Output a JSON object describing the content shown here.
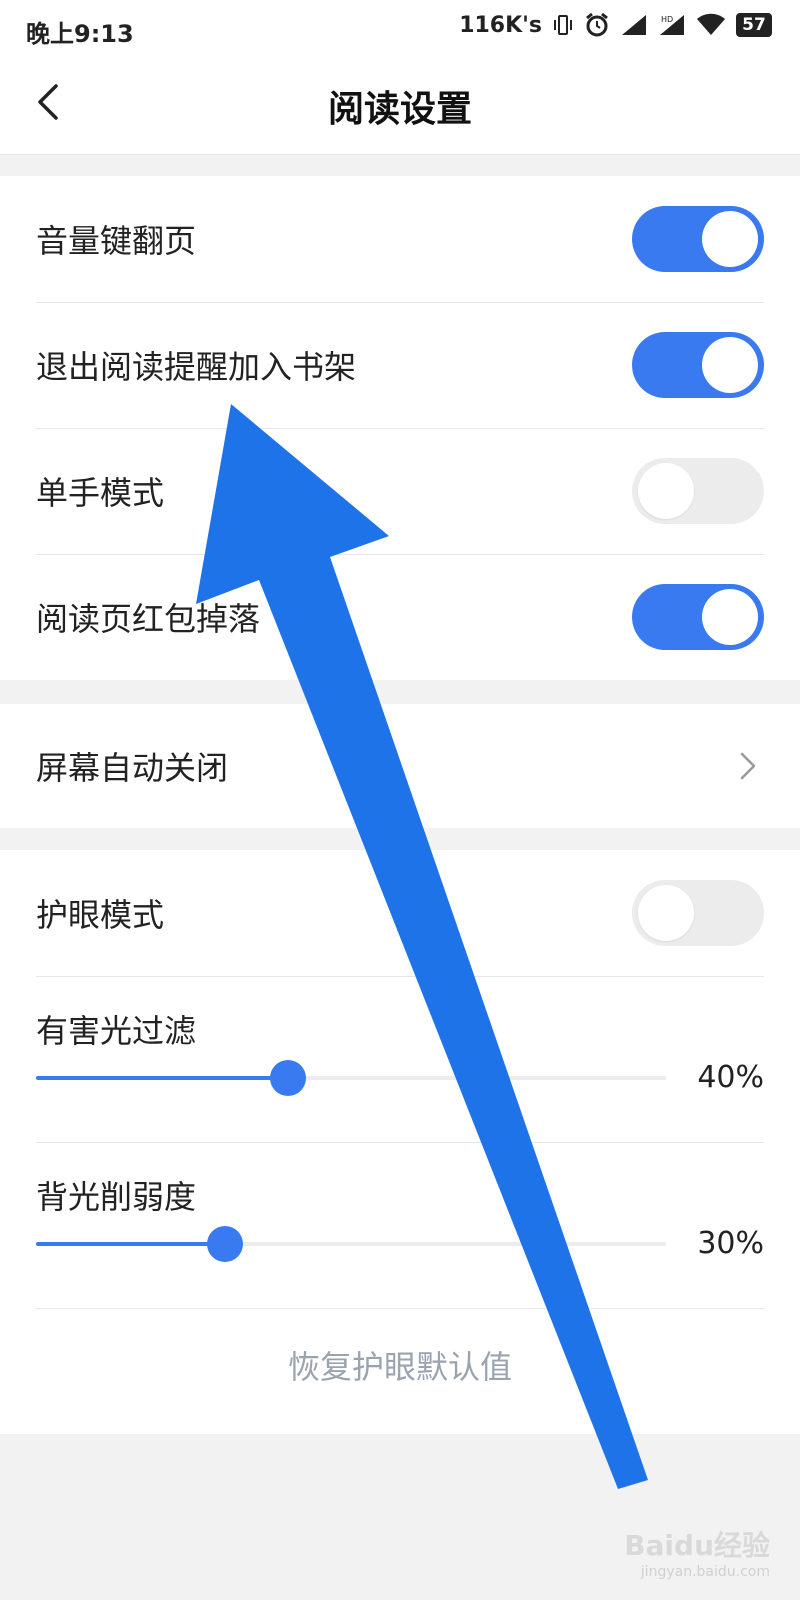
{
  "status_bar": {
    "time": "晚上9:13",
    "net_speed": "116K's",
    "battery": "57"
  },
  "header": {
    "title": "阅读设置",
    "back_icon": "chevron-left-icon"
  },
  "settings_group1": [
    {
      "label": "音量键翻页",
      "toggle": "on"
    },
    {
      "label": "退出阅读提醒加入书架",
      "toggle": "on"
    },
    {
      "label": "单手模式",
      "toggle": "off"
    },
    {
      "label": "阅读页红包掉落",
      "toggle": "on"
    }
  ],
  "screen_off": {
    "label": "屏幕自动关闭",
    "icon": "chevron-right-icon"
  },
  "eye_care": {
    "label": "护眼模式",
    "toggle": "off",
    "blue_light_filter": {
      "label": "有害光过滤",
      "value_text": "40%",
      "value": 0.4
    },
    "backlight_reduce": {
      "label": "背光削弱度",
      "value_text": "30%",
      "value": 0.3
    },
    "reset_label": "恢复护眼默认值"
  },
  "watermark": {
    "brand": "Baidu经验",
    "url": "jingyan.baidu.com"
  },
  "colors": {
    "accent": "#3a7af1",
    "annotation_arrow": "#1f73e8"
  }
}
